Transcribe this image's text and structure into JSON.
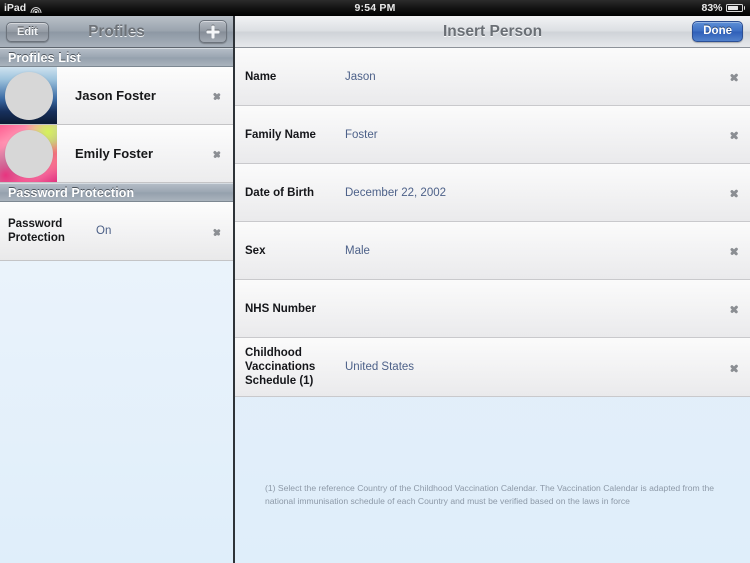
{
  "status_bar": {
    "device_label": "iPad",
    "wifi_icon": "wifi-icon",
    "time": "9:54 PM",
    "battery_percent": "83%",
    "battery_icon": "battery-icon"
  },
  "sidebar": {
    "navbar": {
      "edit_label": "Edit",
      "title": "Profiles",
      "add_icon": "plus-icon"
    },
    "sections": [
      {
        "header": "Profiles List",
        "rows": [
          {
            "name": "Jason Foster",
            "avatar": "avatar-jason",
            "disclosure": "chevron-right-icon"
          },
          {
            "name": "Emily Foster",
            "avatar": "avatar-emily",
            "disclosure": "chevron-right-icon"
          }
        ]
      },
      {
        "header": "Password Protection",
        "rows": [
          {
            "label": "Password Protection",
            "value": "On",
            "disclosure": "chevron-right-icon"
          }
        ]
      }
    ]
  },
  "detail": {
    "navbar": {
      "title": "Insert Person",
      "done_label": "Done"
    },
    "fields": [
      {
        "label": "Name",
        "value": "Jason",
        "disclosure": "chevron-right-icon"
      },
      {
        "label": "Family Name",
        "value": "Foster",
        "disclosure": "chevron-right-icon"
      },
      {
        "label": "Date of Birth",
        "value": "December 22, 2002",
        "disclosure": "chevron-right-icon"
      },
      {
        "label": "Sex",
        "value": "Male",
        "disclosure": "chevron-right-icon"
      },
      {
        "label": "NHS Number",
        "value": "",
        "disclosure": "chevron-right-icon"
      },
      {
        "label": "Childhood Vaccinations Schedule (1)",
        "value": "United States",
        "disclosure": "chevron-right-icon"
      }
    ],
    "footnote": "(1) Select the reference Country of the Childhood Vaccination Calendar. The Vaccination Calendar is adapted from the national immunisation schedule of each Country and must be verified based on the laws in force"
  },
  "colors": {
    "accent_blue": "#3d6fc4",
    "value_text": "#4d6189",
    "section_header": "#9aa5b1",
    "page_background": "#dfeefa"
  }
}
